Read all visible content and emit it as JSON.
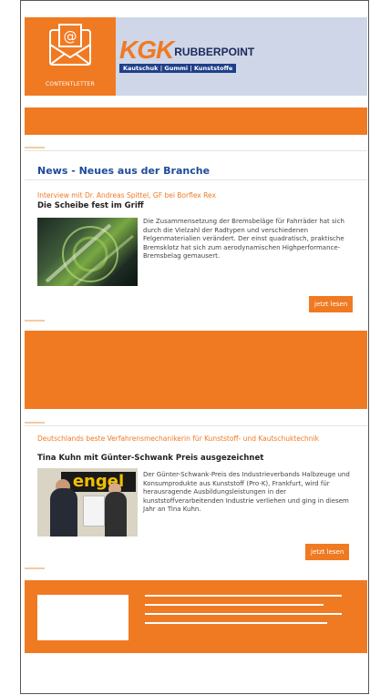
{
  "header": {
    "contentletter_label": "CONTENTLETTER",
    "logo_kgk": "KGK",
    "logo_rubberpoint": "RUBBERPOINT",
    "logo_tagline": "Kautschuk | Gummi | Kunststoffe"
  },
  "section": {
    "title": "News - Neues aus der Branche"
  },
  "articles": [
    {
      "kicker": "Interview mit Dr. Andreas Spittel, GF bei Borflex Rex",
      "title": "Die Scheibe fest im Griff",
      "body": "Die Zusammensetzung der Bremsbeläge für Fahrräder hat sich durch die Vielzahl der Radtypen und verschiedenen Felgenmaterialien verändert. Der einst quadratisch, praktische Bremsklotz hat sich zum aerodynamischen Highperformance-Bremsbelag gemausert.",
      "button": "jetzt lesen"
    },
    {
      "kicker": "Deutschlands beste Verfahrensmechanikerin für Kunststoff- und Kautschuktechnik",
      "title": "Tina Kuhn mit Günter-Schwank Preis ausgezeichnet",
      "body": "Der Günter-Schwank-Preis des Industrieverbands Halbzeuge und Konsumprodukte aus Kunststoff (Pro-K), Frankfurt, wird für herausragende Ausbildungsleistungen in der kunststoffverarbeitenden Industrie verliehen und ging in diesem Jahr an Tina Kuhn.",
      "button": "jetzt lesen",
      "image_text": "engel"
    }
  ],
  "colors": {
    "accent": "#f07a22",
    "header_bg": "#cfd6e8",
    "title_blue": "#1e4a9a",
    "logo_navy": "#1f3f8a"
  }
}
